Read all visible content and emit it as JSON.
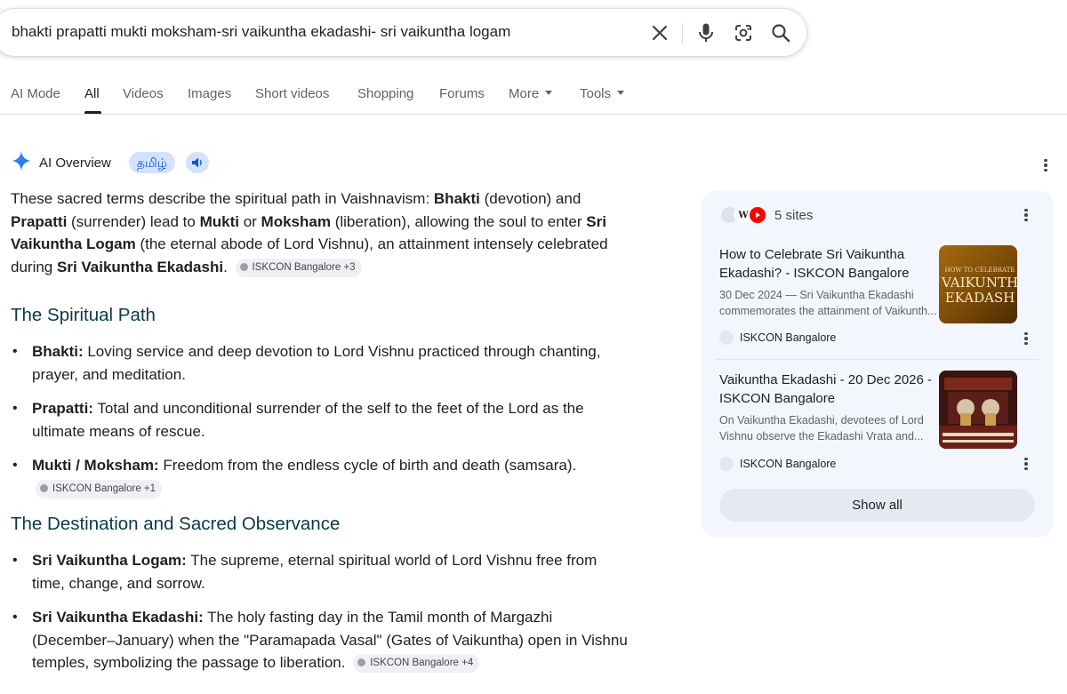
{
  "search": {
    "query": "bhakti prapatti mukti moksham-sri vaikuntha ekadashi- sri vaikuntha logam"
  },
  "tabs": [
    {
      "label": "AI Mode"
    },
    {
      "label": "All"
    },
    {
      "label": "Videos"
    },
    {
      "label": "Images"
    },
    {
      "label": "Short videos"
    },
    {
      "label": "Shopping"
    },
    {
      "label": "Forums"
    },
    {
      "label": "More"
    },
    {
      "label": "Tools"
    }
  ],
  "ai_overview": {
    "title": "AI Overview",
    "language_chip": "தமிழ்",
    "intro": {
      "t1": "These sacred terms describe the spiritual path in Vaishnavism: ",
      "b1": "Bhakti",
      "t2": " (devotion) and ",
      "b2": "Prapatti",
      "t3": " (surrender) lead to ",
      "b3": "Mukti",
      "t4": " or ",
      "b4": "Moksham",
      "t5": " (liberation), allowing the soul to enter ",
      "b5": "Sri Vaikuntha Logam",
      "t6": " (the eternal abode of Lord Vishnu), an attainment intensely celebrated during ",
      "b6": "Sri Vaikuntha Ekadashi",
      "t7": ".",
      "chip": "ISKCON Bangalore +3"
    },
    "section1": {
      "heading": "The Spiritual Path",
      "items": [
        {
          "term": "Bhakti:",
          "text": " Loving service and deep devotion to Lord Vishnu practiced through chanting, prayer, and meditation."
        },
        {
          "term": "Prapatti:",
          "text": " Total and unconditional surrender of the self to the feet of the Lord as the ultimate means of rescue."
        },
        {
          "term": "Mukti / Moksham:",
          "text": " Freedom from the endless cycle of birth and death (samsara).",
          "chip": "ISKCON Bangalore +1"
        }
      ]
    },
    "section2": {
      "heading": "The Destination and Sacred Observance",
      "items": [
        {
          "term": "Sri Vaikuntha Logam:",
          "text": " The supreme, eternal spiritual world of Lord Vishnu free from time, change, and sorrow."
        },
        {
          "term": "Sri Vaikuntha Ekadashi:",
          "text": " The holy fasting day in the Tamil month of Margazhi (December–January) when the \"Paramapada Vasal\" (Gates of Vaikuntha) open in Vishnu temples, symbolizing the passage to liberation.",
          "chip": "ISKCON Bangalore +4"
        }
      ]
    }
  },
  "sources": {
    "sites_label": "5 sites",
    "favicon_w": "W",
    "cards": [
      {
        "title": "How to Celebrate Sri Vaikuntha Ekadashi? - ISKCON Bangalore",
        "snippet": "30 Dec 2024 — Sri Vaikuntha Ekadashi commemorates the attainment of Vaikunth...",
        "source": "ISKCON Bangalore",
        "thumb_small": "HOW TO CELEBRATE",
        "thumb_line1": "VAIKUNTH",
        "thumb_line2": "EKADASH"
      },
      {
        "title": "Vaikuntha Ekadashi - 20 Dec 2026 - ISKCON Bangalore",
        "snippet": "On Vaikuntha Ekadashi, devotees of Lord Vishnu observe the Ekadashi Vrata and...",
        "source": "ISKCON Bangalore"
      }
    ],
    "show_all": "Show all"
  },
  "colors": {
    "accent_blue": "#0b57d0",
    "chip_blue": "#d3e3fd",
    "heading_teal": "#0b3a45",
    "panel_bg": "#f3f6fc",
    "youtube_red": "#ff0000"
  }
}
